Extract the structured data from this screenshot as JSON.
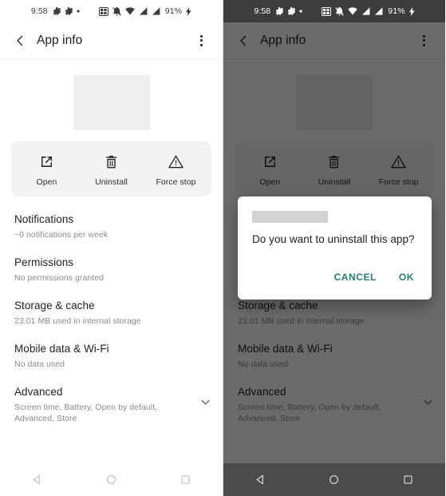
{
  "meta": {
    "accent_teal": "#2a7d72",
    "scrim_color": "rgba(0,0,0,0.58)"
  },
  "status_bar": {
    "time": "9:58",
    "battery_percent": "91%",
    "icons": [
      "accessibility-icon",
      "accessibility-icon",
      "dot-icon",
      "screen-record-icon",
      "notifications-muted-icon",
      "wifi-icon",
      "signal-bars-icon",
      "signal-bars-icon",
      "charging-bolt-icon"
    ]
  },
  "app_bar": {
    "title": "App info",
    "back_icon": "chevron-left-icon",
    "overflow_icon": "more-vert-icon"
  },
  "app_hero": {
    "icon_redacted": true
  },
  "actions": [
    {
      "label": "Open",
      "icon": "open-in-new-icon"
    },
    {
      "label": "Uninstall",
      "icon": "trash-icon"
    },
    {
      "label": "Force stop",
      "icon": "warning-triangle-icon"
    }
  ],
  "settings_rows": [
    {
      "title": "Notifications",
      "subtitle": "~0 notifications per week",
      "chevron": false
    },
    {
      "title": "Permissions",
      "subtitle": "No permissions granted",
      "chevron": false
    },
    {
      "title": "Storage & cache",
      "subtitle": "23.01 MB used in internal storage",
      "chevron": false
    },
    {
      "title": "Mobile data & Wi-Fi",
      "subtitle": "No data used",
      "chevron": false
    },
    {
      "title": "Advanced",
      "subtitle": "Screen time, Battery, Open by default, Advanced, Store",
      "chevron": true
    }
  ],
  "nav_bar": {
    "back": "back-triangle-icon",
    "home": "home-circle-icon",
    "recents": "recents-square-icon"
  },
  "dialog": {
    "title_redacted": true,
    "message": "Do you want to uninstall this app?",
    "cancel_label": "CANCEL",
    "ok_label": "OK"
  }
}
